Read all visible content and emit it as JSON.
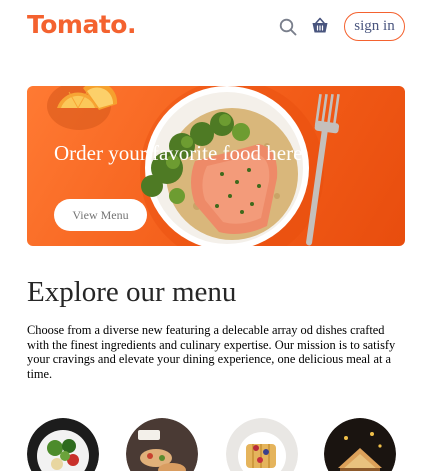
{
  "brand": {
    "name": "Tomato.",
    "accent": "#f4622f"
  },
  "navbar": {
    "search_icon": "search-icon",
    "basket_icon": "basket-icon",
    "signin_label": "sign in"
  },
  "hero": {
    "title": "Order your favorite food here",
    "button_label": "View Menu",
    "background": "#f4622f"
  },
  "menu": {
    "heading": "Explore our menu",
    "description": "Choose from a diverse new featuring a delecable array od dishes crafted with the finest ingredients and culinary expertise. Our mission is to satisfy your cravings and elevate your dining experience, one delicious meal at a time."
  },
  "categories": [
    {
      "icon": "salad-image"
    },
    {
      "icon": "rolls-image"
    },
    {
      "icon": "desserts-image"
    },
    {
      "icon": "sandwich-image"
    }
  ]
}
